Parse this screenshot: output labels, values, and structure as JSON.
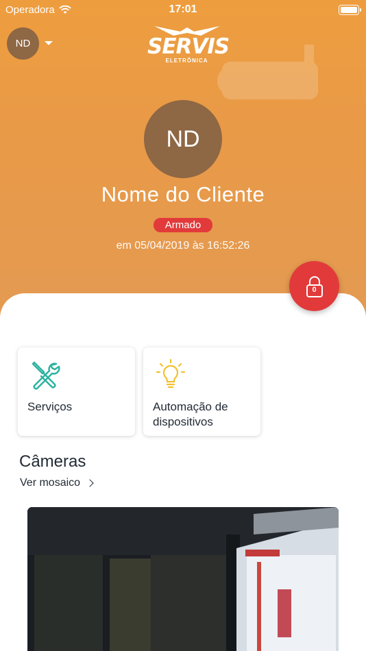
{
  "status_bar": {
    "carrier": "Operadora",
    "time": "17:01"
  },
  "header": {
    "account_initials": "ND",
    "logo": {
      "main": "SERVIS",
      "sub": "ELETRÔNICA"
    }
  },
  "profile": {
    "initials": "ND",
    "name": "Nome do Cliente",
    "status": "Armado",
    "status_time": "em 05/04/2019 às 16:52:26"
  },
  "lock_button": {
    "count": "0",
    "icon": "lock-icon"
  },
  "cards": [
    {
      "label": "Serviços",
      "icon": "tools-icon"
    },
    {
      "label": "Automação de dispositivos",
      "icon": "lightbulb-icon"
    }
  ],
  "cameras": {
    "title": "Câmeras",
    "mosaic_label": "Ver mosaico"
  },
  "colors": {
    "header_orange": "#ee9d3e",
    "alert_red": "#e23a3a",
    "avatar_brown": "#8e6744",
    "tools_teal": "#2bb3a0",
    "bulb_yellow": "#f2c12e",
    "text_dark": "#222b35"
  }
}
